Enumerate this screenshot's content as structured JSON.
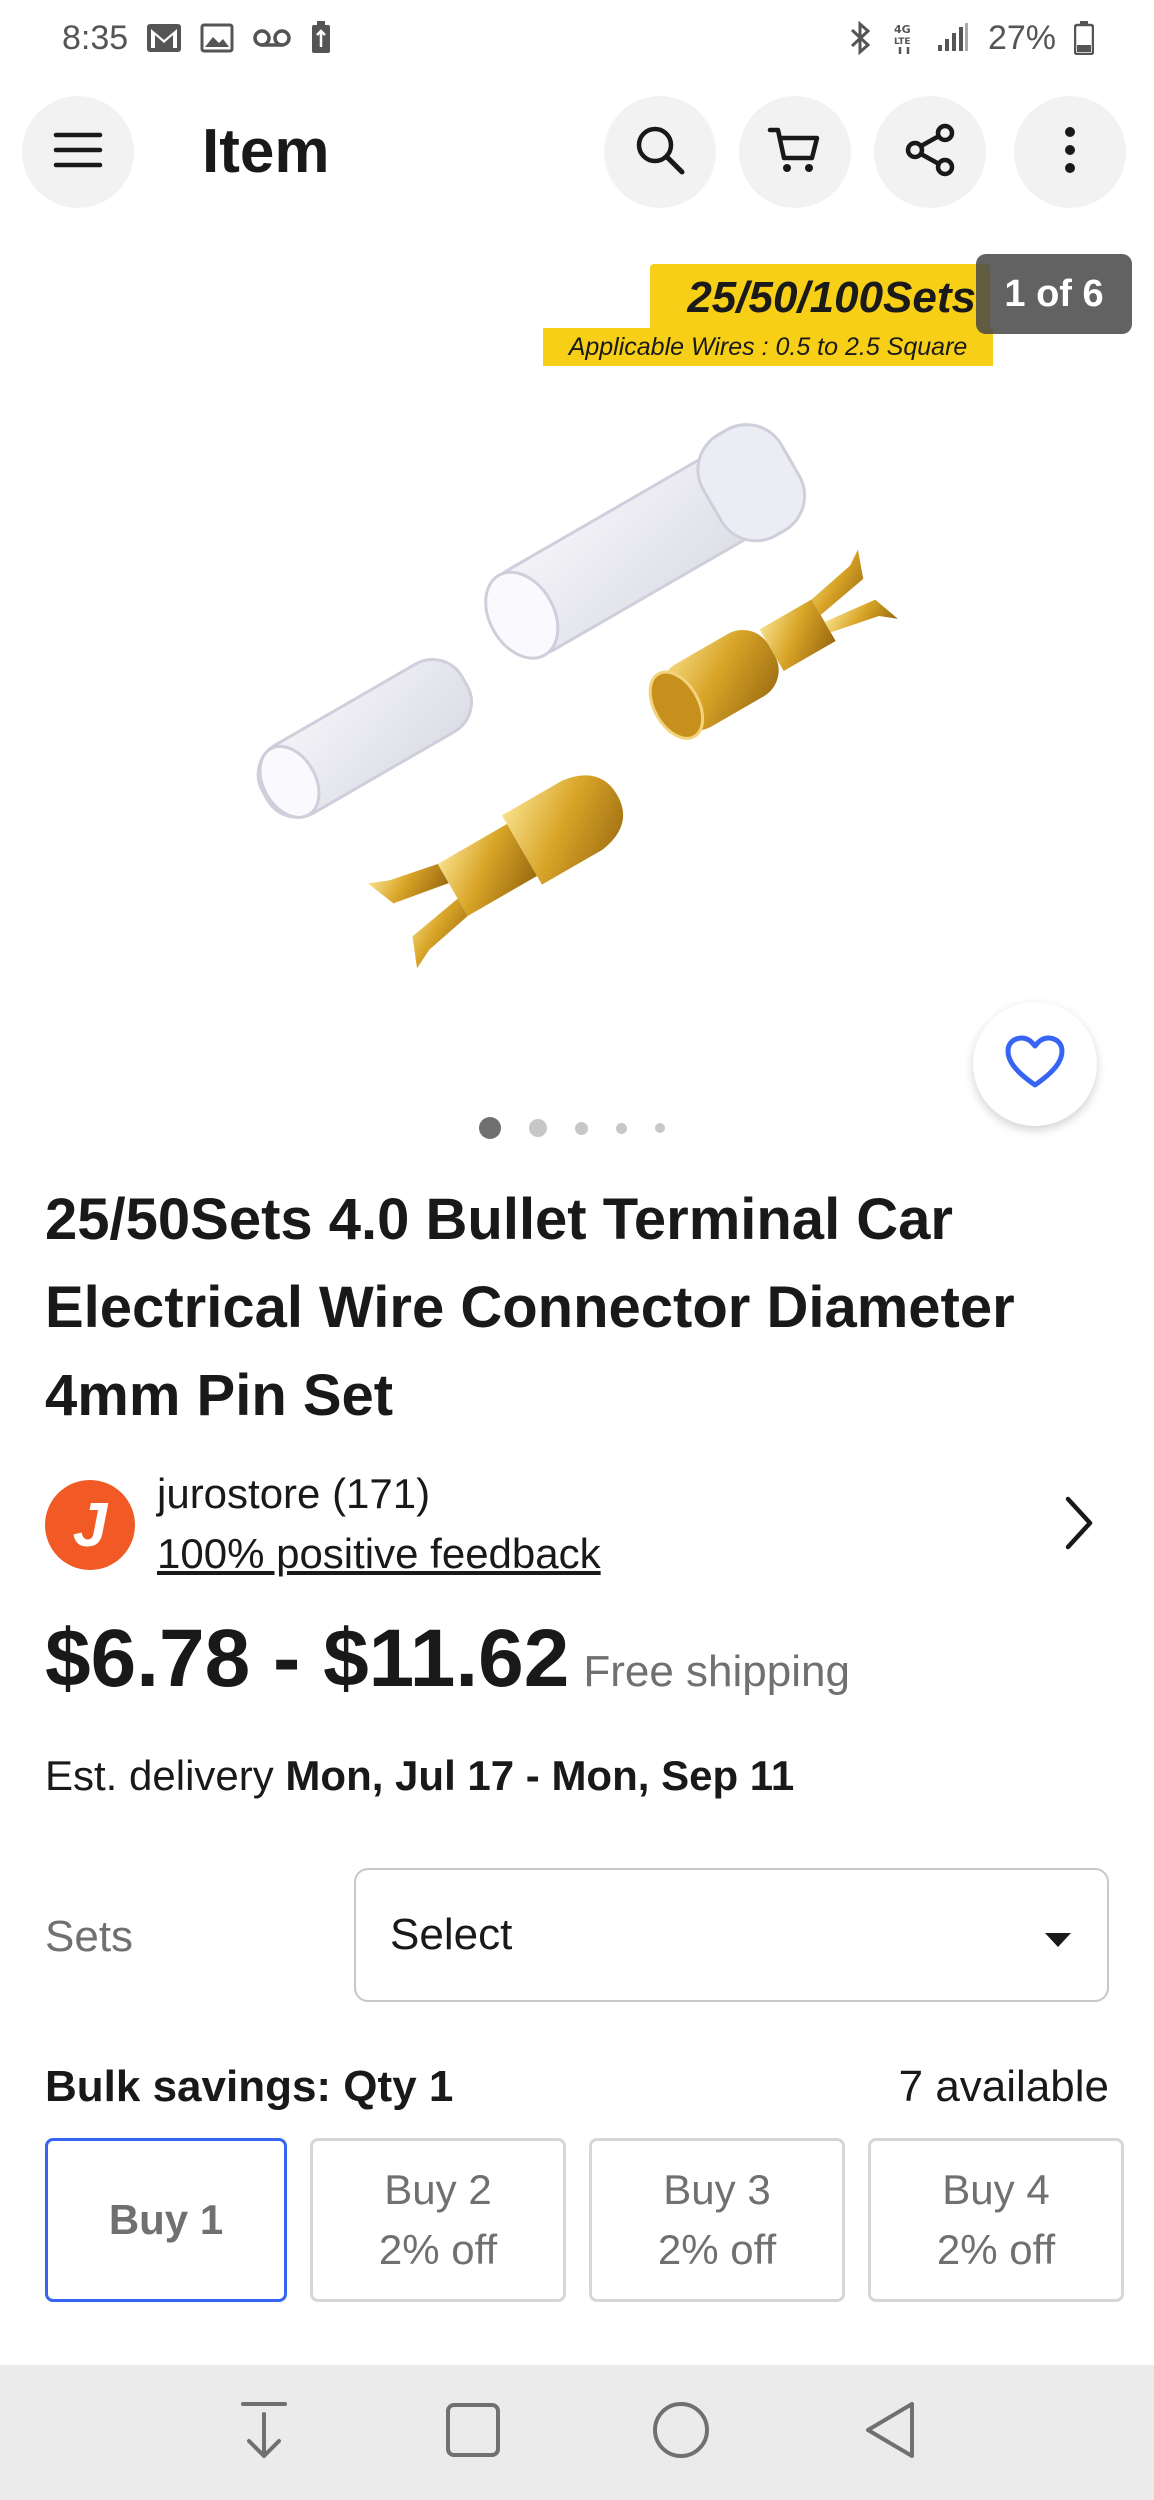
{
  "status_bar": {
    "time": "8:35",
    "battery": "27%"
  },
  "app_bar": {
    "title": "Item"
  },
  "gallery": {
    "banner_main": "25/50/100Sets",
    "banner_sub": "Applicable Wires : 0.5 to 2.5 Square",
    "counter": "1 of 6",
    "dot_count": 5,
    "active_dot": 1
  },
  "listing": {
    "title": "25/50Sets 4.0 Bullet Terminal Car Electrical Wire Connector Diameter 4mm Pin Set"
  },
  "seller": {
    "avatar_letter": "J",
    "name": "jurostore (171)",
    "feedback": "100% positive feedback"
  },
  "price": {
    "range": "$6.78 - $11.62",
    "shipping": "Free shipping"
  },
  "delivery": {
    "prefix": "Est. delivery",
    "dates": "Mon, Jul 17 - Mon, Sep 11"
  },
  "variation": {
    "label": "Sets",
    "selected": "Select"
  },
  "bulk": {
    "label": "Bulk savings: Qty 1",
    "available": "7 available",
    "options": [
      {
        "line1": "Buy 1",
        "line2": ""
      },
      {
        "line1": "Buy 2",
        "line2": "2% off"
      },
      {
        "line1": "Buy 3",
        "line2": "2% off"
      },
      {
        "line1": "Buy 4",
        "line2": "2% off"
      }
    ]
  },
  "colors": {
    "accent_blue": "#3665f3",
    "banner_yellow": "#f6cf16",
    "seller_orange": "#f15a24"
  }
}
